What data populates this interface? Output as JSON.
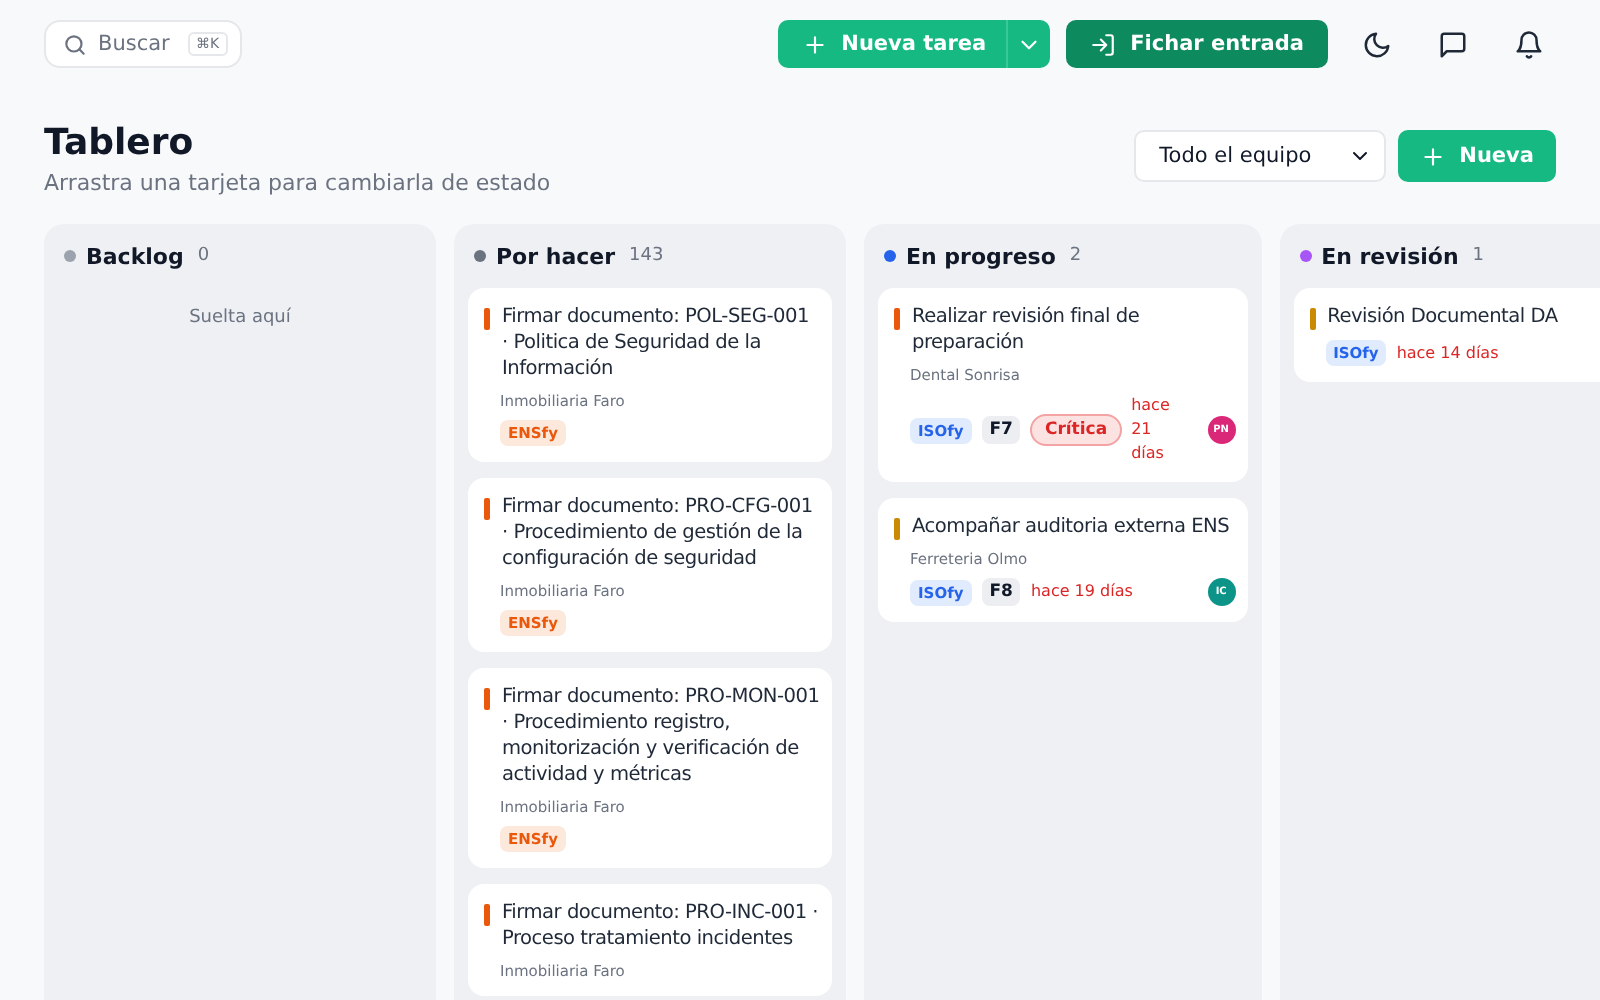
{
  "search": {
    "placeholder": "Buscar",
    "shortcut": "⌘K"
  },
  "actions": {
    "new_task": "Nueva tarea",
    "clock_in": "Fichar entrada"
  },
  "page": {
    "title": "Tablero",
    "subtitle": "Arrastra una tarjeta para cambiarla de estado",
    "team_filter": "Todo el equipo",
    "new_button": "Nueva"
  },
  "columns": [
    {
      "name": "Backlog",
      "count": "0",
      "color": "#9ca3af",
      "empty_text": "Suelta aquí"
    },
    {
      "name": "Por hacer",
      "count": "143",
      "color": "#6b7280",
      "cards": [
        {
          "title": "Firmar documento: POL-SEG-001 · Politica de Seguridad de la Información",
          "client": "Inmobiliaria Faro",
          "color": "#ea580c",
          "tags": [
            {
              "kind": "ens",
              "label": "ENSfy"
            }
          ]
        },
        {
          "title": "Firmar documento: PRO-CFG-001 · Procedimiento de gestión de la configuración de seguridad",
          "client": "Inmobiliaria Faro",
          "color": "#ea580c",
          "tags": [
            {
              "kind": "ens",
              "label": "ENSfy"
            }
          ]
        },
        {
          "title": "Firmar documento: PRO-MON-001 · Procedimiento registro, monitorización y verificación de actividad y métricas",
          "client": "Inmobiliaria Faro",
          "color": "#ea580c",
          "tags": [
            {
              "kind": "ens",
              "label": "ENSfy"
            }
          ]
        },
        {
          "title": "Firmar documento: PRO-INC-001 · Proceso tratamiento incidentes",
          "client": "Inmobiliaria Faro",
          "color": "#ea580c"
        }
      ]
    },
    {
      "name": "En progreso",
      "count": "2",
      "color": "#2563eb",
      "cards": [
        {
          "title": "Realizar revisión final de preparación",
          "client": "Dental Sonrisa",
          "color": "#ea580c",
          "tags": [
            {
              "kind": "iso",
              "label": "ISOfy"
            },
            {
              "kind": "code",
              "label": "F7"
            },
            {
              "kind": "critical",
              "label": "Crítica"
            }
          ],
          "due": "hace 21 días",
          "avatar": {
            "initials": "PN",
            "color": "#db2777"
          }
        },
        {
          "title": "Acompañar auditoria externa ENS",
          "client": "Ferreteria Olmo",
          "color": "#ca8a04",
          "tags": [
            {
              "kind": "iso",
              "label": "ISOfy"
            },
            {
              "kind": "code",
              "label": "F8"
            }
          ],
          "due": "hace 19 días",
          "avatar": {
            "initials": "IC",
            "color": "#0d9488"
          }
        }
      ]
    },
    {
      "name": "En revisión",
      "count": "1",
      "color": "#a855f7",
      "cards": [
        {
          "title": "Revisión Documental DA",
          "color": "#ca8a04",
          "tags": [
            {
              "kind": "iso",
              "label": "ISOfy"
            }
          ],
          "due": "hace 14 días"
        }
      ]
    }
  ]
}
